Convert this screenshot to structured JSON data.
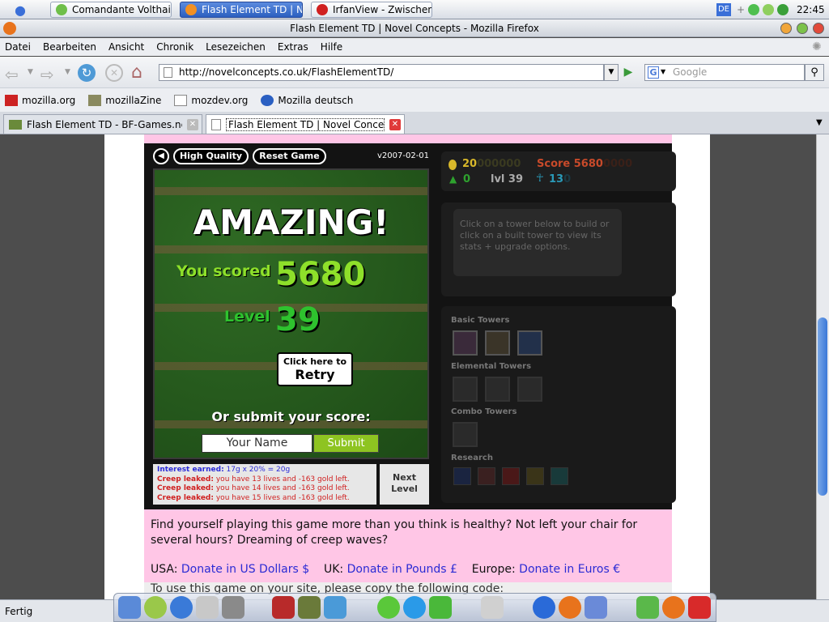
{
  "taskbar": {
    "tasks": [
      {
        "label": "Comandante Volthai..."
      },
      {
        "label": "Flash Element TD | N..."
      },
      {
        "label": "IrfanView - Zwischen..."
      }
    ],
    "lang": "DE",
    "clock": "22:45"
  },
  "window": {
    "title": "Flash Element TD | Novel Concepts - Mozilla Firefox"
  },
  "menu": [
    "Datei",
    "Bearbeiten",
    "Ansicht",
    "Chronik",
    "Lesezeichen",
    "Extras",
    "Hilfe"
  ],
  "nav": {
    "url": "http://novelconcepts.co.uk/FlashElementTD/",
    "search_placeholder": "Google"
  },
  "bookmarks": [
    "mozilla.org",
    "mozillaZine",
    "mozdev.org",
    "Mozilla deutsch"
  ],
  "tabs": [
    {
      "label": "Flash Element TD - BF-Games.net F..."
    },
    {
      "label": "Flash Element TD | Novel Conce..."
    }
  ],
  "game": {
    "buttons": {
      "quality": "High Quality",
      "reset": "Reset Game"
    },
    "version": "v2007-02-01",
    "amazing": "AMAZING!",
    "you_scored_label": "You scored",
    "score": "5680",
    "level_label": "Level",
    "level": "39",
    "retry_small": "Click here to",
    "retry_big": "Retry",
    "submit_heading": "Or submit your score:",
    "name_placeholder": "Your Name",
    "submit_label": "Submit",
    "log": [
      {
        "label": "Interest earned:",
        "text": "17g x 20% = 20g",
        "type": "interest"
      },
      {
        "label": "Creep leaked:",
        "text": "you have 13 lives and -163 gold left.",
        "type": "leak"
      },
      {
        "label": "Creep leaked:",
        "text": "you have 14 lives and -163 gold left.",
        "type": "leak"
      },
      {
        "label": "Creep leaked:",
        "text": "you have 15 lives and -163 gold left.",
        "type": "leak"
      }
    ],
    "next_level": "Next Level",
    "stats": {
      "gold": "20",
      "gold_pad": "000000",
      "score_label": "Score",
      "score": "5680",
      "score_pad": "0000",
      "lives": "0",
      "level_text": "lvl 39",
      "creeps": "13",
      "creeps_pad": "0"
    },
    "info_text": "Click on a tower below to build or click on a built tower to view its stats + upgrade options.",
    "sections": {
      "basic": "Basic Towers",
      "elemental": "Elemental Towers",
      "combo": "Combo Towers",
      "research": "Research"
    }
  },
  "page": {
    "text1": "Find yourself playing this game more than you think is healthy? Not left your chair for several hours? Dreaming of creep waves?",
    "usa_label": "USA:",
    "usa_link": "Donate in US Dollars $",
    "uk_label": "UK:",
    "uk_link": "Donate in Pounds £",
    "eu_label": "Europe:",
    "eu_link": "Donate in Euros €",
    "grey_text": "To use this game on your site, please copy the following code:"
  },
  "status": "Fertig"
}
